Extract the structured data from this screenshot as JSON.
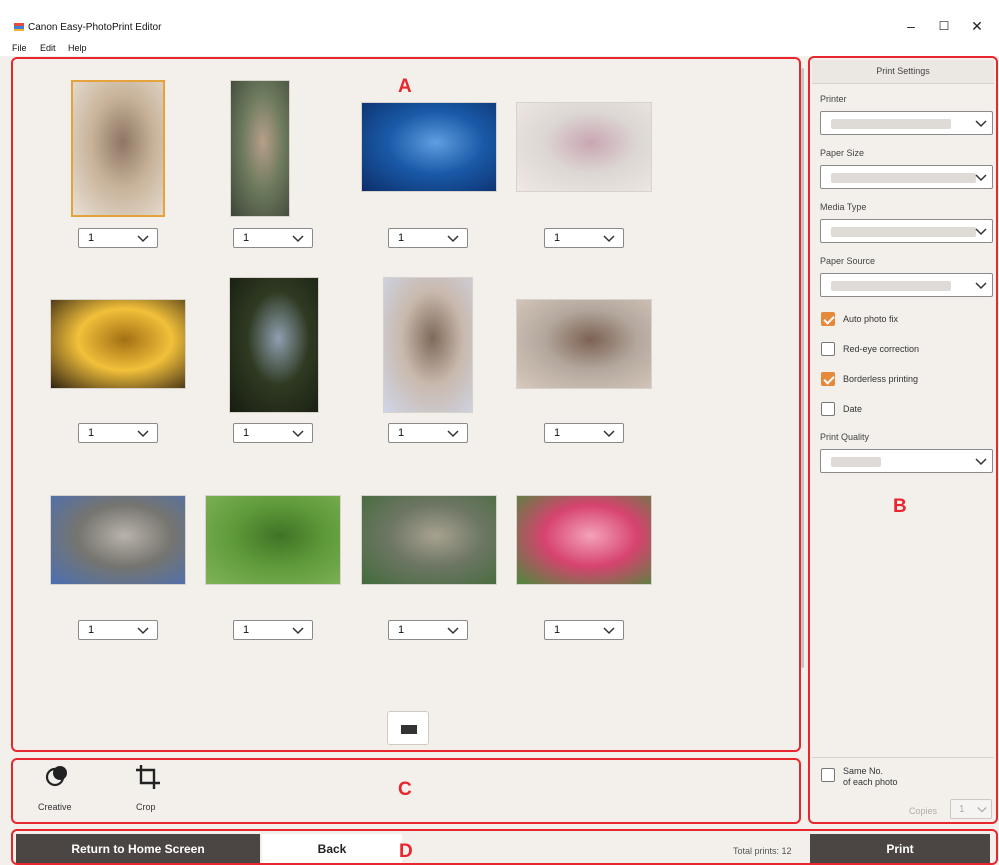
{
  "window": {
    "title": "Canon Easy-PhotoPrint Editor",
    "minimize": "–",
    "maximize": "☐",
    "close": "✕"
  },
  "menu": [
    "File",
    "Edit",
    "Help"
  ],
  "labels": {
    "a": "A",
    "b": "B",
    "c": "C",
    "d": "D"
  },
  "photos": [
    {
      "copies": "1",
      "colors": [
        "#c8b39a",
        "#8d7664",
        "#e8e0d6"
      ],
      "selected": true
    },
    {
      "copies": "1",
      "colors": [
        "#6e7b5e",
        "#b79f8a",
        "#3d4538"
      ]
    },
    {
      "copies": "1",
      "colors": [
        "#1a5aa8",
        "#5f9ee0",
        "#0c2e6a"
      ]
    },
    {
      "copies": "1",
      "colors": [
        "#ddd7d4",
        "#c9a6b2",
        "#efe8e3"
      ]
    },
    {
      "copies": "1",
      "colors": [
        "#f2c03a",
        "#a27013",
        "#302212"
      ]
    },
    {
      "copies": "1",
      "colors": [
        "#2f3a22",
        "#8f9fb0",
        "#171c10"
      ]
    },
    {
      "copies": "1",
      "colors": [
        "#c9b9ad",
        "#7f6a5a",
        "#cfd6e8"
      ]
    },
    {
      "copies": "1",
      "colors": [
        "#b4a89e",
        "#7c6252",
        "#d8c9bd"
      ]
    },
    {
      "copies": "1",
      "colors": [
        "#76756f",
        "#b9b3ab",
        "#4b6fb3"
      ]
    },
    {
      "copies": "1",
      "colors": [
        "#5e9a3a",
        "#3f7325",
        "#7fb458"
      ]
    },
    {
      "copies": "1",
      "colors": [
        "#6d7664",
        "#a8a290",
        "#436b3a"
      ]
    },
    {
      "copies": "1",
      "colors": [
        "#d6436f",
        "#f4a2b9",
        "#4b8a3b"
      ]
    }
  ],
  "sidebar": {
    "header": "Print Settings",
    "printer_label": "Printer",
    "paper_size_label": "Paper Size",
    "media_type_label": "Media Type",
    "paper_source_label": "Paper Source",
    "print_quality_label": "Print Quality",
    "checks": [
      {
        "label": "Auto photo fix",
        "checked": true
      },
      {
        "label": "Red-eye correction",
        "checked": false
      },
      {
        "label": "Borderless printing",
        "checked": true
      },
      {
        "label": "Date",
        "checked": false
      }
    ],
    "same_no_line1": "Same No.",
    "same_no_line2": "of each photo",
    "copies_label": "Copies",
    "copies_value": "1"
  },
  "tools": {
    "creative_label": "Creative",
    "crop_label": "Crop"
  },
  "bottom": {
    "home_label": "Return to Home Screen",
    "back_label": "Back",
    "total_prints": "Total prints: 12",
    "print_label": "Print"
  },
  "colors": {
    "accent_red": "#e8262d",
    "check_orange": "#e58a3c",
    "dark_button": "#4b4643"
  }
}
